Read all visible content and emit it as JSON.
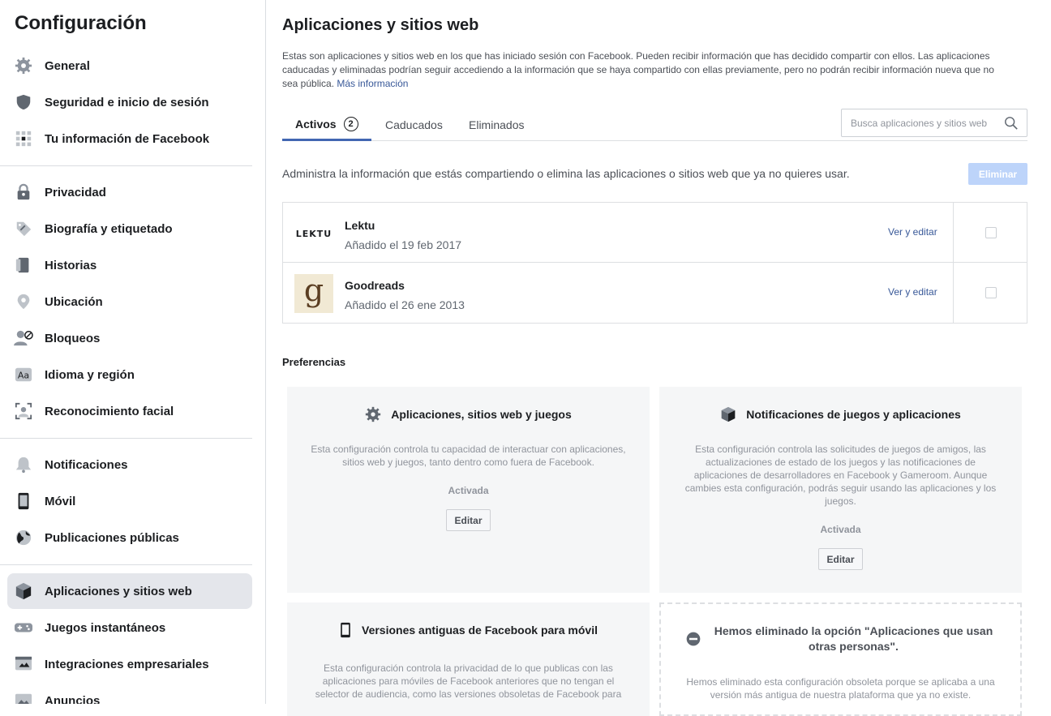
{
  "sidebar": {
    "title": "Configuración",
    "items": [
      {
        "label": "General",
        "icon": "gear-icon"
      },
      {
        "label": "Seguridad e inicio de sesión",
        "icon": "shield-icon"
      },
      {
        "label": "Tu información de Facebook",
        "icon": "grid-icon"
      },
      {
        "label": "Privacidad",
        "icon": "lock-icon"
      },
      {
        "label": "Biografía y etiquetado",
        "icon": "tag-icon"
      },
      {
        "label": "Historias",
        "icon": "book-icon"
      },
      {
        "label": "Ubicación",
        "icon": "location-pin-icon"
      },
      {
        "label": "Bloqueos",
        "icon": "block-user-icon"
      },
      {
        "label": "Idioma y región",
        "icon": "language-icon"
      },
      {
        "label": "Reconocimiento facial",
        "icon": "face-scan-icon"
      },
      {
        "label": "Notificaciones",
        "icon": "bell-icon"
      },
      {
        "label": "Móvil",
        "icon": "phone-icon"
      },
      {
        "label": "Publicaciones públicas",
        "icon": "globe-icon"
      },
      {
        "label": "Aplicaciones y sitios web",
        "icon": "box-icon"
      },
      {
        "label": "Juegos instantáneos",
        "icon": "gamepad-icon"
      },
      {
        "label": "Integraciones empresariales",
        "icon": "business-icon"
      },
      {
        "label": "Anuncios",
        "icon": "ads-icon"
      }
    ]
  },
  "main": {
    "title": "Aplicaciones y sitios web",
    "intro": "Estas son aplicaciones y sitios web en los que has iniciado sesión con Facebook. Pueden recibir información que has decidido compartir con ellos. Las aplicaciones caducadas y eliminadas podrían seguir accediendo a la información que se haya compartido con ellas previamente, pero no podrán recibir información nueva que no sea pública.",
    "more_link": "Más información",
    "tabs": [
      {
        "label": "Activos",
        "badge": "2"
      },
      {
        "label": "Caducados"
      },
      {
        "label": "Eliminados"
      }
    ],
    "search": {
      "placeholder": "Busca aplicaciones y sitios web"
    },
    "manage_text": "Administra la información que estás compartiendo o elimina las aplicaciones o sitios web que ya no quieres usar.",
    "delete_button": "Eliminar",
    "apps": [
      {
        "name": "Lektu",
        "logo_text": "LEKTU",
        "date": "Añadido el 19 feb 2017",
        "edit": "Ver y editar"
      },
      {
        "name": "Goodreads",
        "logo_text": "g",
        "date": "Añadido el 26 ene 2013",
        "edit": "Ver y editar"
      }
    ],
    "preferences_title": "Preferencias",
    "cards": [
      {
        "title": "Aplicaciones, sitios web y juegos",
        "icon": "gear-icon",
        "desc": "Esta configuración controla tu capacidad de interactuar con aplicaciones, sitios web y juegos, tanto dentro como fuera de Facebook.",
        "status": "Activada",
        "button": "Editar"
      },
      {
        "title": "Notificaciones de juegos y aplicaciones",
        "icon": "cube-icon",
        "desc": "Esta configuración controla las solicitudes de juegos de amigos, las actualizaciones de estado de los juegos y las notificaciones de aplicaciones de desarrolladores en Facebook y Gameroom. Aunque cambies esta configuración, podrás seguir usando las aplicaciones y los juegos.",
        "status": "Activada",
        "button": "Editar"
      },
      {
        "title": "Versiones antiguas de Facebook para móvil",
        "icon": "phone-icon",
        "desc": "Esta configuración controla la privacidad de lo que publicas con las aplicaciones para móviles de Facebook anteriores que no tengan el selector de audiencia, como las versiones obsoletas de Facebook para"
      },
      {
        "title": "Hemos eliminado la opción \"Aplicaciones que usan otras personas\".",
        "icon": "minus-circle-icon",
        "desc": "Hemos eliminado esta configuración obsoleta porque se aplicaba a una versión más antigua de nuestra plataforma que ya no existe."
      }
    ]
  },
  "colors": {
    "accent": "#4267b2",
    "link": "#385898",
    "delete_disabled": "#bdd4fa",
    "card_bg": "#f5f6f7"
  }
}
